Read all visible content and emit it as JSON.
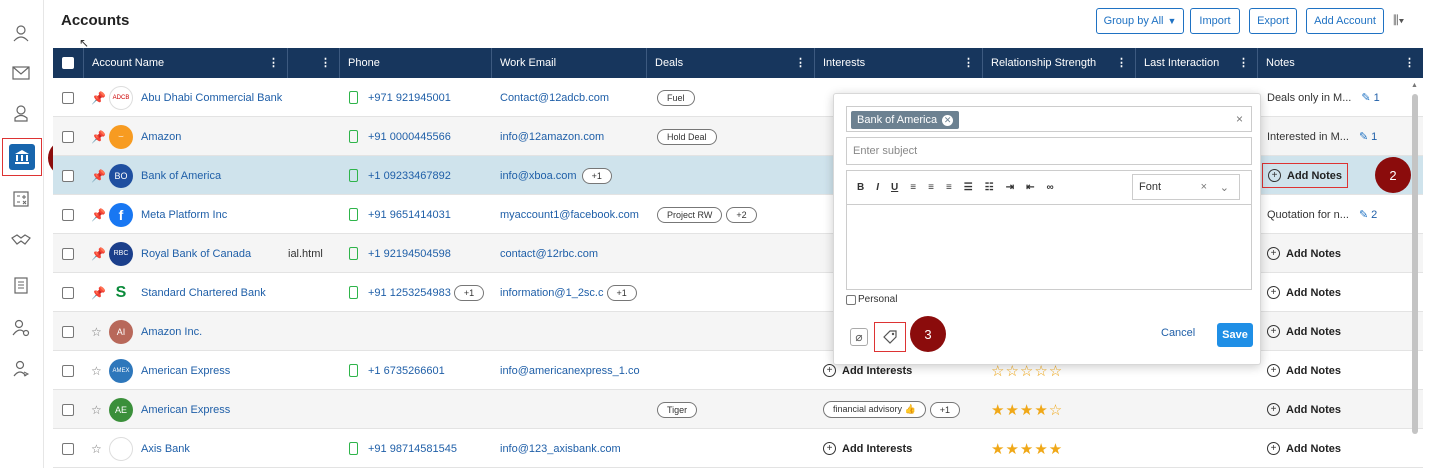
{
  "header": {
    "title": "Accounts",
    "buttons": {
      "group_by": "Group by All",
      "import": "Import",
      "export": "Export",
      "add_account": "Add Account"
    }
  },
  "sidebar": {
    "icons": [
      "contacts-icon",
      "mail-icon",
      "user-icon",
      "bank-icon",
      "calculator-icon",
      "handshake-icon",
      "clipboard-icon",
      "user-settings-icon",
      "user-arrow-icon"
    ]
  },
  "table": {
    "columns": [
      "Account Name",
      "",
      "Phone",
      "Work Email",
      "Deals",
      "Interests",
      "Relationship Strength",
      "Last Interaction",
      "Notes"
    ],
    "rows": [
      {
        "name": "Abu Dhabi Commercial Bank",
        "avatar": "ADCB",
        "pinned": true,
        "phone": "+971 921945001",
        "phone_more": "",
        "email": "Contact@12adcb.com",
        "email_more": "",
        "deals": [
          "Fuel"
        ],
        "deals_more": "",
        "interests": "",
        "notes": "Deals only in M...",
        "note_count": "1",
        "stars": 0
      },
      {
        "name": "Amazon",
        "avatar": "",
        "pinned": true,
        "phone": "+91 0000445566",
        "phone_more": "",
        "email": "info@12amazon.com",
        "email_more": "",
        "deals": [
          "Hold Deal"
        ],
        "deals_more": "",
        "interests": "",
        "notes": "Interested in M...",
        "note_count": "1",
        "stars": 0
      },
      {
        "name": "Bank of America",
        "avatar": "BO",
        "pinned": true,
        "phone": "+1 09233467892",
        "phone_more": "",
        "email": "info@xboa.com",
        "email_more": "+1",
        "deals": [],
        "deals_more": "",
        "interests": "",
        "notes": "Add Notes",
        "note_count": "",
        "stars": 0
      },
      {
        "name": "Meta Platform Inc",
        "avatar": "",
        "pinned": true,
        "phone": "+91 9651414031",
        "phone_more": "",
        "email": "myaccount1@facebook.com",
        "email_more": "",
        "deals": [
          "Project RW"
        ],
        "deals_more": "+2",
        "interests": "",
        "notes": "Quotation for n...",
        "note_count": "2",
        "stars": 0
      },
      {
        "name": "Royal Bank of Canada",
        "avatar": "",
        "pinned": true,
        "extra": "ial.html",
        "phone": "+1 92194504598",
        "phone_more": "",
        "email": "contact@12rbc.com",
        "email_more": "",
        "deals": [],
        "deals_more": "",
        "interests": "",
        "notes": "Add Notes",
        "note_count": "",
        "stars": 0
      },
      {
        "name": "Standard Chartered Bank",
        "avatar": "",
        "pinned": true,
        "phone": "+91 1253254983",
        "phone_more": "+1",
        "email": "information@1_2sc.c",
        "email_more": "+1",
        "deals": [],
        "deals_more": "",
        "interests": "",
        "notes": "Add Notes",
        "note_count": "",
        "stars": 0
      },
      {
        "name": "Amazon Inc.",
        "avatar": "AI",
        "pinned": false,
        "phone": "",
        "phone_more": "",
        "email": "",
        "email_more": "",
        "deals": [],
        "deals_more": "",
        "interests": "",
        "notes": "Add Notes",
        "note_count": "",
        "stars": 0
      },
      {
        "name": "American Express",
        "avatar": "",
        "pinned": false,
        "phone": "+1 6735266601",
        "phone_more": "",
        "email": "info@americanexpress_1.co",
        "email_more": "",
        "deals": [],
        "deals_more": "",
        "interests": "Add Interests",
        "notes": "Add Notes",
        "note_count": "",
        "stars": 0,
        "stars_empty": 5
      },
      {
        "name": "American Express",
        "avatar": "AE",
        "pinned": false,
        "phone": "",
        "phone_more": "",
        "email": "",
        "email_more": "",
        "deals": [
          "Tiger"
        ],
        "deals_more": "",
        "interests": "financial advisory",
        "interests_more": "+1",
        "notes": "Add Notes",
        "note_count": "",
        "stars": 4
      },
      {
        "name": "Axis Bank",
        "avatar": "",
        "pinned": false,
        "phone": "+91 98714581545",
        "phone_more": "",
        "email": "info@123_axisbank.com",
        "email_more": "",
        "deals": [],
        "deals_more": "",
        "interests": "Add Interests",
        "notes": "Add Notes",
        "note_count": "",
        "stars": 5
      }
    ]
  },
  "popup": {
    "chip": "Bank of America",
    "subject_placeholder": "Enter subject",
    "toolbar": [
      "B",
      "I",
      "U"
    ],
    "font": "Font",
    "personal": "Personal",
    "cancel": "Cancel",
    "save": "Save"
  },
  "callouts": [
    "1",
    "2",
    "3"
  ],
  "colors": {
    "header": "#17365d",
    "accent": "#1f72c3",
    "callout": "#8b0c0c",
    "selected_row": "#cfe3ec"
  }
}
